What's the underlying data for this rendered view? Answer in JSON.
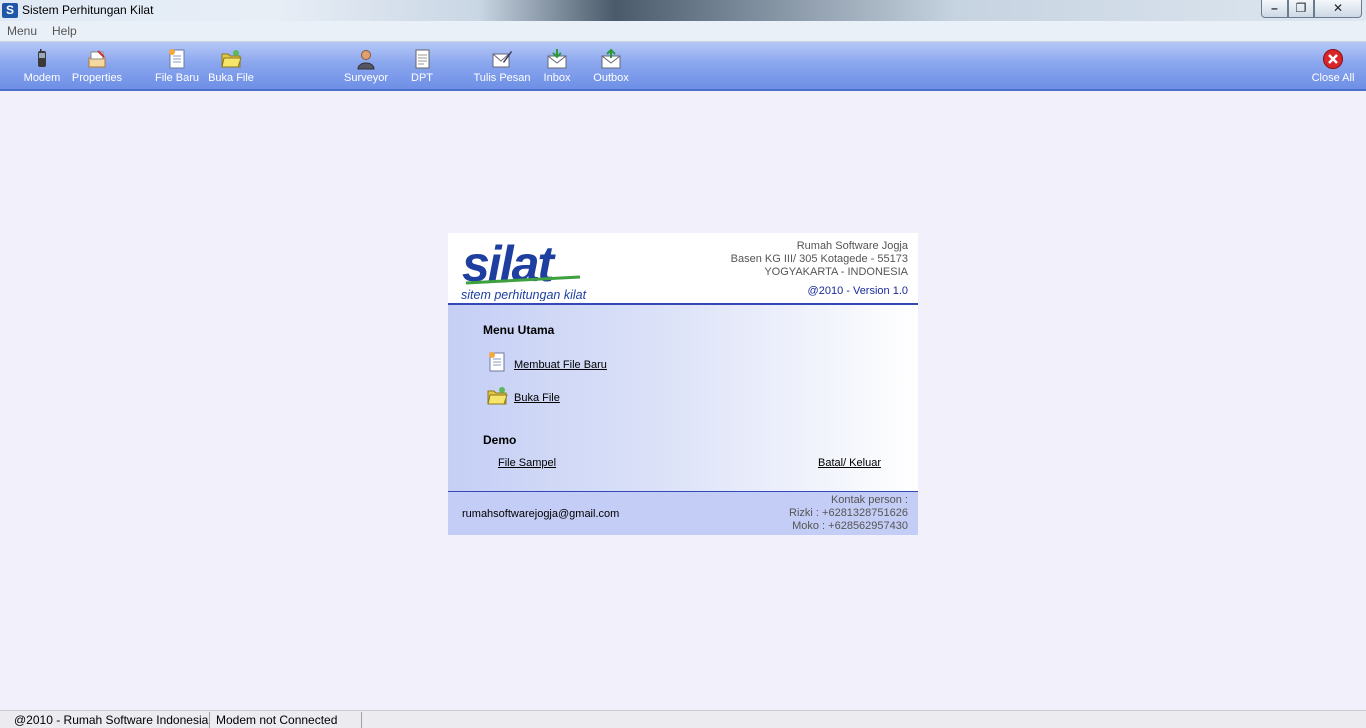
{
  "window": {
    "title": "Sistem Perhitungan Kilat",
    "app_icon_letter": "S",
    "minimize": "–",
    "maximize": "❐",
    "close": "✕"
  },
  "menubar": {
    "items": [
      {
        "label": "Menu"
      },
      {
        "label": "Help"
      }
    ]
  },
  "toolbar": {
    "buttons": [
      {
        "label": "Modem",
        "icon": "modem-phone-icon"
      },
      {
        "label": "Properties",
        "icon": "properties-icon"
      },
      {
        "label": "File Baru",
        "icon": "new-file-icon"
      },
      {
        "label": "Buka File",
        "icon": "open-folder-icon"
      },
      {
        "label": "Surveyor",
        "icon": "user-icon"
      },
      {
        "label": "DPT",
        "icon": "document-icon"
      },
      {
        "label": "Tulis Pesan",
        "icon": "write-message-icon"
      },
      {
        "label": "Inbox",
        "icon": "inbox-envelope-icon"
      },
      {
        "label": "Outbox",
        "icon": "outbox-envelope-icon"
      },
      {
        "label": "Close All",
        "icon": "close-all-icon"
      }
    ]
  },
  "panel": {
    "logo_text": "silat",
    "logo_tagline": "sitem perhitungan kilat",
    "company": {
      "line1": "Rumah Software Jogja",
      "line2": "Basen KG III/ 305  Kotagede - 55173",
      "line3": "YOGYAKARTA - INDONESIA"
    },
    "version": "@2010 - Version 1.0",
    "menu_utama_title": "Menu Utama",
    "link_new_file": "Membuat File Baru",
    "link_open_file": "Buka File",
    "demo_title": "Demo",
    "link_sample": "File Sampel",
    "link_cancel": "Batal/ Keluar",
    "email": "rumahsoftwarejogja@gmail.com",
    "contact": {
      "line1": "Kontak person :",
      "line2": "Rizki : +6281328751626",
      "line3": "Moko : +628562957430"
    }
  },
  "statusbar": {
    "copyright": "@2010  -  Rumah Software Indonesia",
    "modem_status": "Modem not Connected"
  },
  "colors": {
    "toolbar_top": "#b5c8f7",
    "toolbar_bottom": "#6e8fe6",
    "brand_blue": "#1f3fa0",
    "link_accent": "#3448b8"
  }
}
